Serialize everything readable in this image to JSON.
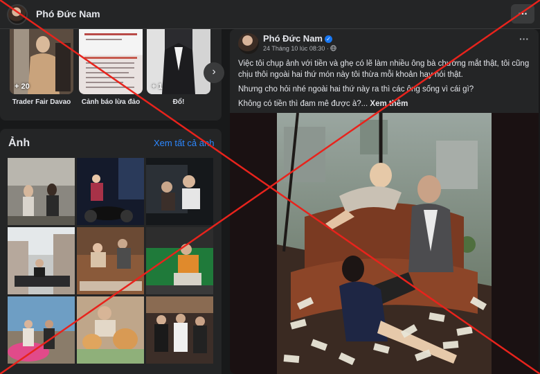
{
  "header": {
    "name": "Phó Đức Nam",
    "more_label": "..."
  },
  "groups": [
    {
      "badge": "+ 20",
      "label": "Trader Fair Davao"
    },
    {
      "badge": "",
      "label": "Cảnh báo lừa đảo"
    },
    {
      "badge": "+ 1",
      "label": "Đổ!"
    }
  ],
  "groups_next_icon": "chevron-right-icon",
  "photos": {
    "title": "Ảnh",
    "see_all": "Xem tất cả ảnh"
  },
  "post": {
    "author": "Phó Đức Nam",
    "verified": "✓",
    "timestamp": "24 Tháng 10 lúc 08:30 ·",
    "privacy_icon": "globe-icon",
    "more": "···",
    "paragraphs": [
      "Việc tôi chụp ảnh với tiền và ghẹ có lẽ làm nhiều ông bà chướng mắt thật, tôi cũng chịu thôi ngoài hai thứ món này tôi thừa mỗi khoản hay nói thật.",
      "Nhưng cho hỏi nhé ngoài hai thứ này ra thì các ông sống vì cái gì?",
      "Không có tiền thì đam mê được à?..."
    ],
    "see_more": "Xem thêm"
  },
  "overlay": {
    "mark": "red-x",
    "color": "#e8231c"
  }
}
